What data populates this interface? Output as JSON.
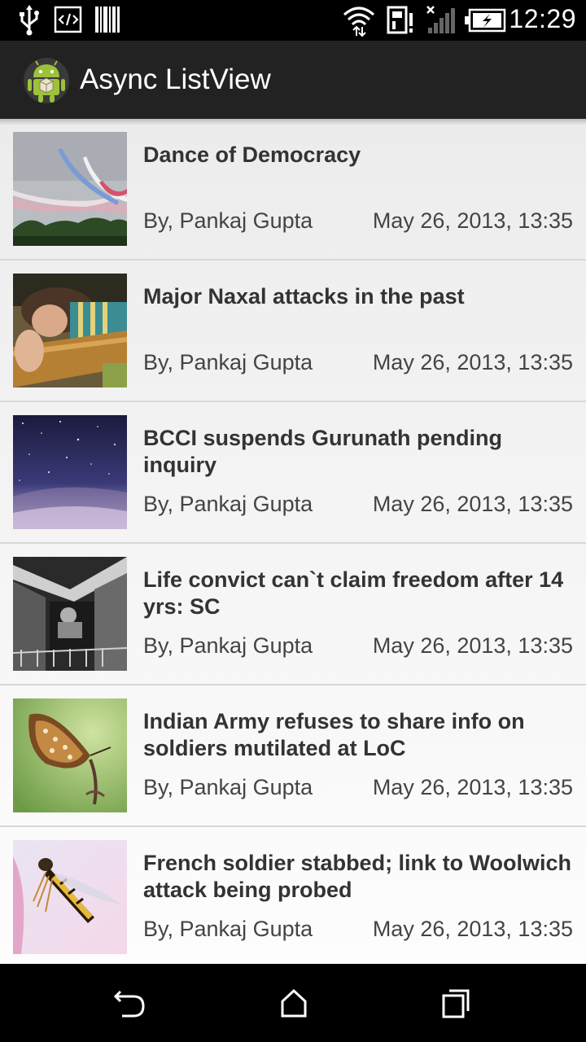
{
  "status_bar": {
    "time": "12:29",
    "icons": [
      "usb-icon",
      "developer-code-icon",
      "barcode-icon",
      "wifi-icon",
      "sd-card-alert-icon",
      "signal-no-service-icon",
      "battery-charging-icon"
    ]
  },
  "action_bar": {
    "title": "Async ListView",
    "icon": "android-app-icon"
  },
  "list": {
    "items": [
      {
        "title": "Dance of Democracy",
        "author": "By, Pankaj Gupta",
        "date": "May 26, 2013, 13:35",
        "thumb": "air-show-jets"
      },
      {
        "title": "Major Naxal attacks in the past",
        "author": "By, Pankaj Gupta",
        "date": "May 26, 2013, 13:35",
        "thumb": "girl-lying-on-log"
      },
      {
        "title": "BCCI suspends Gurunath pending inquiry",
        "author": "By, Pankaj Gupta",
        "date": "May 26, 2013, 13:35",
        "thumb": "night-starry-sky"
      },
      {
        "title": "Life convict can`t claim freedom after 14 yrs: SC",
        "author": "By, Pankaj Gupta",
        "date": "May 26, 2013, 13:35",
        "thumb": "old-man-window-bw"
      },
      {
        "title": "Indian Army refuses to share info on soldiers mutilated at LoC",
        "author": "By, Pankaj Gupta",
        "date": "May 26, 2013, 13:35",
        "thumb": "butterfly-on-stem"
      },
      {
        "title": "French soldier stabbed; link to Woolwich attack being probed",
        "author": "By, Pankaj Gupta",
        "date": "May 26, 2013, 13:35",
        "thumb": "hoverfly-insect"
      }
    ]
  },
  "nav_bar": {
    "buttons": [
      "back-icon",
      "home-icon",
      "recent-apps-icon"
    ]
  }
}
